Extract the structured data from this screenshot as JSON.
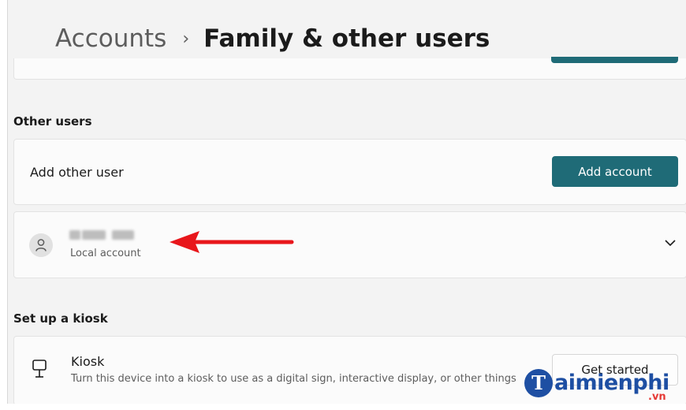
{
  "breadcrumb": {
    "parent": "Accounts",
    "separator": "›",
    "current": "Family & other users"
  },
  "other_users": {
    "title": "Other users",
    "add_label": "Add other user",
    "add_button": "Add account",
    "user": {
      "account_type": "Local account",
      "avatar_icon": "person-icon",
      "expand_icon": "chevron-down-icon"
    }
  },
  "kiosk": {
    "title": "Set up a kiosk",
    "name": "Kiosk",
    "description": "Turn this device into a kiosk to use as a digital sign, interactive display, or other things",
    "button": "Get started",
    "icon": "kiosk-icon"
  },
  "annotation": {
    "arrow_color": "#e8161b"
  },
  "watermark": {
    "letter": "T",
    "text": "aimienphi",
    "suffix": ".vn"
  },
  "colors": {
    "accent": "#1f6b77",
    "background": "#f3f3f3",
    "card": "#fbfbfb"
  }
}
